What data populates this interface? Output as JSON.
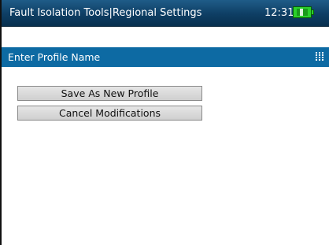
{
  "titlebar": {
    "title": "Fault Isolation Tools|Regional Settings",
    "time": "12:31",
    "battery_icon": "battery-charging-icon"
  },
  "header": {
    "label": "Enter Profile Name",
    "keypad_icon": "keypad-icon"
  },
  "buttons": {
    "save_label": "Save As New Profile",
    "cancel_label": "Cancel Modifications"
  },
  "colors": {
    "titlebar": "#0e3e64",
    "header_band": "#0d6aa3",
    "battery": "#2bd12b"
  }
}
